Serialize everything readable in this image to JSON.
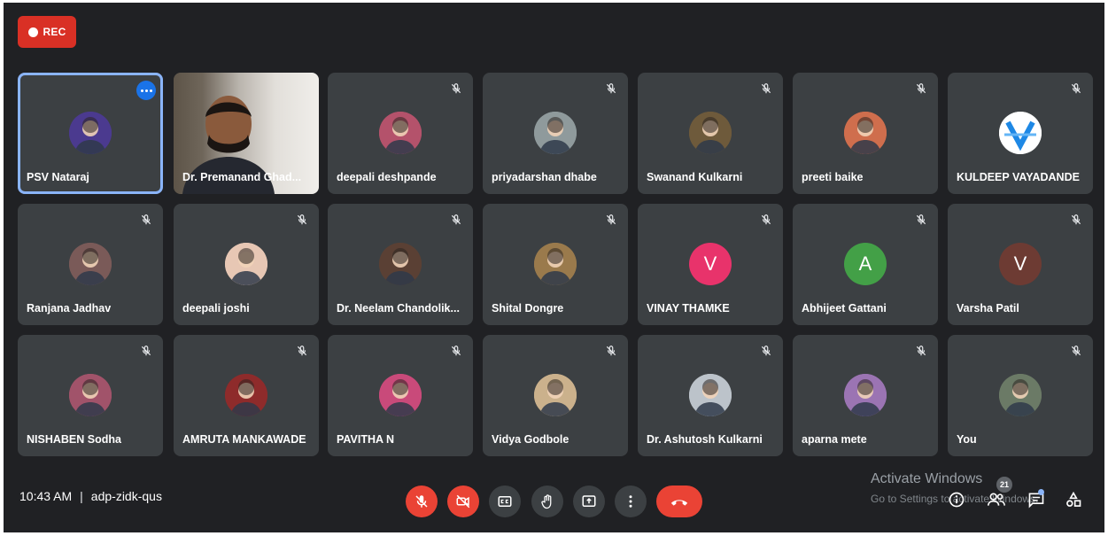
{
  "recording": {
    "label": "REC",
    "color": "#d93025"
  },
  "participants": [
    {
      "name": "PSV Nataraj",
      "avatar": "photo",
      "bg": "#4b3a8f",
      "active": true,
      "menu": true
    },
    {
      "name": "Dr. Premanand Ghad...",
      "avatar": "video"
    },
    {
      "name": "deepali deshpande",
      "avatar": "photo",
      "bg": "#b4526b",
      "muted": true
    },
    {
      "name": "priyadarshan dhabe",
      "avatar": "photo",
      "bg": "#8f9a9c",
      "muted": true
    },
    {
      "name": "Swanand Kulkarni",
      "avatar": "photo",
      "bg": "#6e5a3b",
      "muted": true
    },
    {
      "name": "preeti baike",
      "avatar": "photo",
      "bg": "#cf6e4d",
      "muted": true
    },
    {
      "name": "KULDEEP VAYADANDE",
      "avatar": "logo",
      "bg": "#ffffff",
      "muted": true
    },
    {
      "name": "Ranjana Jadhav",
      "avatar": "photo",
      "bg": "#7a5a58",
      "muted": true
    },
    {
      "name": "deepali joshi",
      "avatar": "photo",
      "bg": "#e7c7b4",
      "muted": true
    },
    {
      "name": "Dr. Neelam Chandolik...",
      "avatar": "photo",
      "bg": "#5a4034",
      "muted": true
    },
    {
      "name": "Shital Dongre",
      "avatar": "photo",
      "bg": "#9a7a4c",
      "muted": true
    },
    {
      "name": "VINAY THAMKE",
      "avatar": "letter",
      "letter": "V",
      "bg": "#e8336b",
      "muted": true
    },
    {
      "name": "Abhijeet Gattani",
      "avatar": "letter",
      "letter": "A",
      "bg": "#43a047",
      "muted": true
    },
    {
      "name": "Varsha Patil",
      "avatar": "letter",
      "letter": "V",
      "bg": "#6d3b33",
      "muted": true
    },
    {
      "name": "NISHABEN Sodha",
      "avatar": "photo",
      "bg": "#a1536a",
      "muted": true
    },
    {
      "name": "AMRUTA MANKAWADE",
      "avatar": "photo",
      "bg": "#8e2b2b",
      "muted": true
    },
    {
      "name": "PAVITHA N",
      "avatar": "photo",
      "bg": "#c94a7a",
      "muted": true
    },
    {
      "name": "Vidya Godbole",
      "avatar": "photo",
      "bg": "#cbb18c",
      "muted": true
    },
    {
      "name": "Dr. Ashutosh Kulkarni",
      "avatar": "photo",
      "bg": "#bcc3ca",
      "muted": true
    },
    {
      "name": "aparna mete",
      "avatar": "photo",
      "bg": "#9b74b3",
      "muted": true
    },
    {
      "name": "You",
      "avatar": "photo",
      "bg": "#6b7a66",
      "muted": true
    }
  ],
  "meeting": {
    "time": "10:43 AM",
    "separator": "|",
    "code": "adp-zidk-qus"
  },
  "watermark": {
    "line1": "Activate Windows",
    "line2": "Go to Settings to activate Windows."
  },
  "people_count": "21",
  "icons": {
    "mic": "mic-off-icon",
    "cam": "camera-off-icon",
    "cc": "captions-icon",
    "hand": "raise-hand-icon",
    "present": "present-screen-icon",
    "more": "more-vert-icon",
    "hangup": "call-end-icon",
    "info": "info-icon",
    "people": "people-icon",
    "chat": "chat-icon",
    "activities": "activities-icon"
  }
}
